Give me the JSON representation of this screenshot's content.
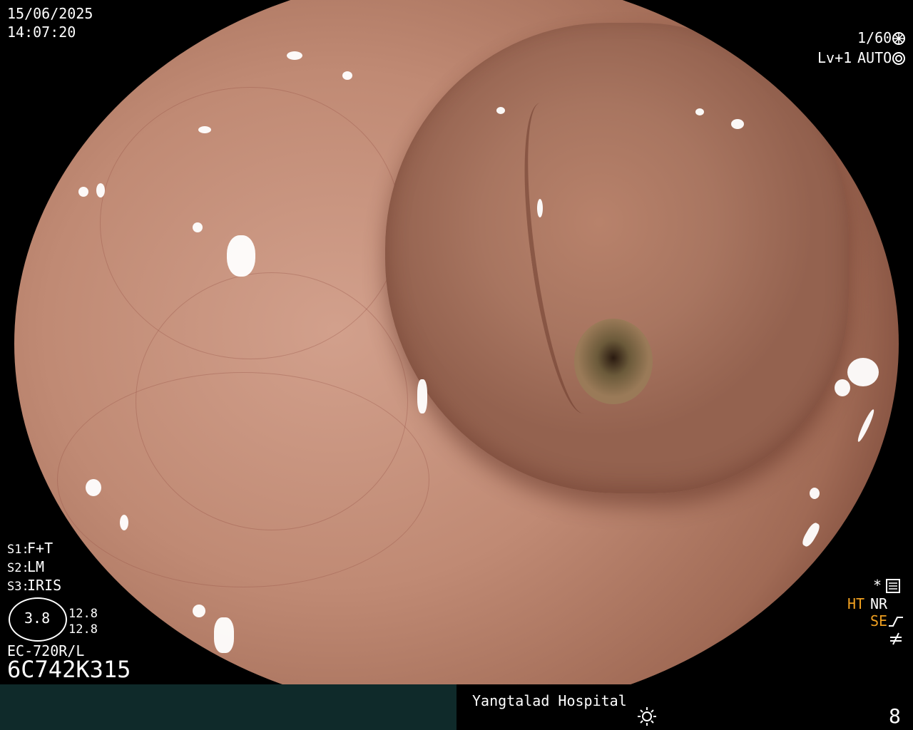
{
  "overlay": {
    "date": "15/06/2025",
    "time": "14:07:20",
    "shutter": "1/60",
    "level": "Lv+1",
    "mode": "AUTO",
    "s1": "F+T",
    "s2": "LM",
    "s3": "IRIS",
    "s1_label": "S1:",
    "s2_label": "S2:",
    "s3_label": "S3:",
    "iris_value": "3.8",
    "iris_top": "12.8",
    "iris_bottom": "12.8",
    "scope_model": "EC-720R/L",
    "serial": "6C742K315",
    "ht": "HT",
    "nr": "NR",
    "se": "SE",
    "hospital": "Yangtalad Hospital",
    "counter": "8"
  },
  "icons": {
    "shutter": "aperture-icon",
    "auto": "camera-icon",
    "settings": "settings-icon",
    "brightness": "sun-icon"
  },
  "colors": {
    "accent": "#f0a020",
    "bottom_bar": "#0f2a2a"
  }
}
